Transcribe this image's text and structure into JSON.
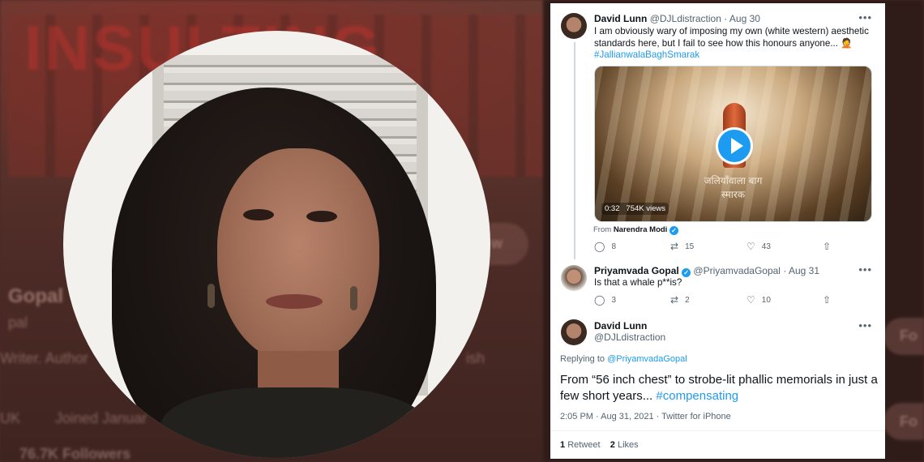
{
  "background": {
    "banner_text": "INSULTING",
    "profile_name": "Gopal",
    "profile_handle": "pal",
    "bio": "Writer. Author",
    "bio_tail": "ish",
    "location": "UK",
    "joined": "Joined Januar",
    "followers": "76.7K Followers",
    "follow_button": "Fo",
    "follow_button2": "Fo",
    "view_button": "w"
  },
  "tweet1": {
    "name": "David Lunn",
    "handle": "@DJLdistraction",
    "date": "· Aug 30",
    "text": "I am obviously wary of imposing my own (white western) aesthetic standards here, but I fail to see how this honours anyone... 🤦",
    "hashtag": "#JallianwalaBaghSmarak",
    "media_caption_line1": "जलियाँवाला बाग",
    "media_caption_line2": "स्मारक",
    "media_duration": "0:32",
    "media_views": "754K views",
    "from_label": "From",
    "from_name": "Narendra Modi",
    "replies": "8",
    "retweets": "15",
    "likes": "43"
  },
  "tweet2": {
    "name": "Priyamvada Gopal",
    "handle": "@PriyamvadaGopal",
    "date": "· Aug 31",
    "text": "Is that a whale p**is?",
    "replies": "3",
    "retweets": "2",
    "likes": "10"
  },
  "tweet3": {
    "name": "David Lunn",
    "handle": "@DJLdistraction",
    "replying_label": "Replying to",
    "replying_to": "@PriyamvadaGopal",
    "text": "From “56 inch chest” to strobe-lit phallic memorials in just a few short years...",
    "hashtag": "#compensating",
    "meta": "2:05 PM · Aug 31, 2021 · Twitter for iPhone",
    "retweet_count": "1",
    "retweet_label": "Retweet",
    "like_count": "2",
    "like_label": "Likes"
  },
  "icons": {
    "more": "more-icon",
    "reply": "reply-icon",
    "retweet": "retweet-icon",
    "like": "heart-icon",
    "share": "share-icon",
    "verified": "verified-icon",
    "play": "play-icon"
  },
  "colors": {
    "accent": "#1d9bf0",
    "text": "#0f1419",
    "muted": "#536471"
  }
}
